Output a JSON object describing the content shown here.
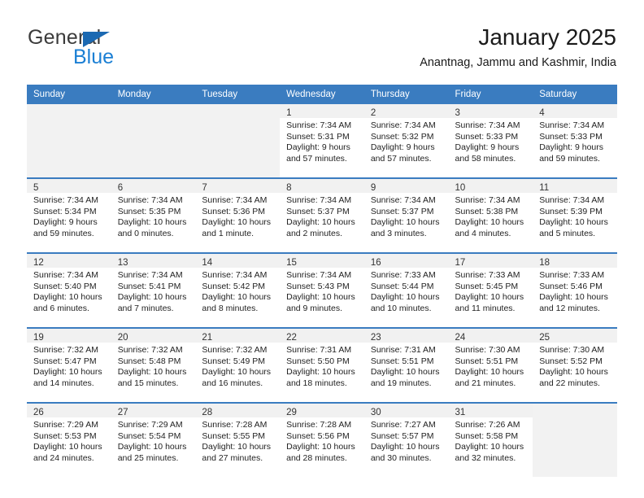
{
  "brand": {
    "name_top": "General",
    "name_bottom": "Blue",
    "triangle_color": "#1b69b2",
    "blue_color": "#1b7fd4"
  },
  "header": {
    "title": "January 2025",
    "subtitle": "Anantnag, Jammu and Kashmir, India"
  },
  "theme": {
    "header_row_bg": "#3a7cc0",
    "daynum_band_bg": "#f1f1f1",
    "empty_cell_bg": "#f2f2f2"
  },
  "weekday_headers": [
    "Sunday",
    "Monday",
    "Tuesday",
    "Wednesday",
    "Thursday",
    "Friday",
    "Saturday"
  ],
  "labels": {
    "sunrise_prefix": "Sunrise:",
    "sunset_prefix": "Sunset:",
    "daylight_prefix": "Daylight:"
  },
  "weeks": [
    [
      {
        "empty": true
      },
      {
        "empty": true
      },
      {
        "empty": true
      },
      {
        "day": "1",
        "sunrise": "Sunrise: 7:34 AM",
        "sunset": "Sunset: 5:31 PM",
        "daylight_line1": "Daylight: 9 hours",
        "daylight_line2": "and 57 minutes."
      },
      {
        "day": "2",
        "sunrise": "Sunrise: 7:34 AM",
        "sunset": "Sunset: 5:32 PM",
        "daylight_line1": "Daylight: 9 hours",
        "daylight_line2": "and 57 minutes."
      },
      {
        "day": "3",
        "sunrise": "Sunrise: 7:34 AM",
        "sunset": "Sunset: 5:33 PM",
        "daylight_line1": "Daylight: 9 hours",
        "daylight_line2": "and 58 minutes."
      },
      {
        "day": "4",
        "sunrise": "Sunrise: 7:34 AM",
        "sunset": "Sunset: 5:33 PM",
        "daylight_line1": "Daylight: 9 hours",
        "daylight_line2": "and 59 minutes."
      }
    ],
    [
      {
        "day": "5",
        "sunrise": "Sunrise: 7:34 AM",
        "sunset": "Sunset: 5:34 PM",
        "daylight_line1": "Daylight: 9 hours",
        "daylight_line2": "and 59 minutes."
      },
      {
        "day": "6",
        "sunrise": "Sunrise: 7:34 AM",
        "sunset": "Sunset: 5:35 PM",
        "daylight_line1": "Daylight: 10 hours",
        "daylight_line2": "and 0 minutes."
      },
      {
        "day": "7",
        "sunrise": "Sunrise: 7:34 AM",
        "sunset": "Sunset: 5:36 PM",
        "daylight_line1": "Daylight: 10 hours",
        "daylight_line2": "and 1 minute."
      },
      {
        "day": "8",
        "sunrise": "Sunrise: 7:34 AM",
        "sunset": "Sunset: 5:37 PM",
        "daylight_line1": "Daylight: 10 hours",
        "daylight_line2": "and 2 minutes."
      },
      {
        "day": "9",
        "sunrise": "Sunrise: 7:34 AM",
        "sunset": "Sunset: 5:37 PM",
        "daylight_line1": "Daylight: 10 hours",
        "daylight_line2": "and 3 minutes."
      },
      {
        "day": "10",
        "sunrise": "Sunrise: 7:34 AM",
        "sunset": "Sunset: 5:38 PM",
        "daylight_line1": "Daylight: 10 hours",
        "daylight_line2": "and 4 minutes."
      },
      {
        "day": "11",
        "sunrise": "Sunrise: 7:34 AM",
        "sunset": "Sunset: 5:39 PM",
        "daylight_line1": "Daylight: 10 hours",
        "daylight_line2": "and 5 minutes."
      }
    ],
    [
      {
        "day": "12",
        "sunrise": "Sunrise: 7:34 AM",
        "sunset": "Sunset: 5:40 PM",
        "daylight_line1": "Daylight: 10 hours",
        "daylight_line2": "and 6 minutes."
      },
      {
        "day": "13",
        "sunrise": "Sunrise: 7:34 AM",
        "sunset": "Sunset: 5:41 PM",
        "daylight_line1": "Daylight: 10 hours",
        "daylight_line2": "and 7 minutes."
      },
      {
        "day": "14",
        "sunrise": "Sunrise: 7:34 AM",
        "sunset": "Sunset: 5:42 PM",
        "daylight_line1": "Daylight: 10 hours",
        "daylight_line2": "and 8 minutes."
      },
      {
        "day": "15",
        "sunrise": "Sunrise: 7:34 AM",
        "sunset": "Sunset: 5:43 PM",
        "daylight_line1": "Daylight: 10 hours",
        "daylight_line2": "and 9 minutes."
      },
      {
        "day": "16",
        "sunrise": "Sunrise: 7:33 AM",
        "sunset": "Sunset: 5:44 PM",
        "daylight_line1": "Daylight: 10 hours",
        "daylight_line2": "and 10 minutes."
      },
      {
        "day": "17",
        "sunrise": "Sunrise: 7:33 AM",
        "sunset": "Sunset: 5:45 PM",
        "daylight_line1": "Daylight: 10 hours",
        "daylight_line2": "and 11 minutes."
      },
      {
        "day": "18",
        "sunrise": "Sunrise: 7:33 AM",
        "sunset": "Sunset: 5:46 PM",
        "daylight_line1": "Daylight: 10 hours",
        "daylight_line2": "and 12 minutes."
      }
    ],
    [
      {
        "day": "19",
        "sunrise": "Sunrise: 7:32 AM",
        "sunset": "Sunset: 5:47 PM",
        "daylight_line1": "Daylight: 10 hours",
        "daylight_line2": "and 14 minutes."
      },
      {
        "day": "20",
        "sunrise": "Sunrise: 7:32 AM",
        "sunset": "Sunset: 5:48 PM",
        "daylight_line1": "Daylight: 10 hours",
        "daylight_line2": "and 15 minutes."
      },
      {
        "day": "21",
        "sunrise": "Sunrise: 7:32 AM",
        "sunset": "Sunset: 5:49 PM",
        "daylight_line1": "Daylight: 10 hours",
        "daylight_line2": "and 16 minutes."
      },
      {
        "day": "22",
        "sunrise": "Sunrise: 7:31 AM",
        "sunset": "Sunset: 5:50 PM",
        "daylight_line1": "Daylight: 10 hours",
        "daylight_line2": "and 18 minutes."
      },
      {
        "day": "23",
        "sunrise": "Sunrise: 7:31 AM",
        "sunset": "Sunset: 5:51 PM",
        "daylight_line1": "Daylight: 10 hours",
        "daylight_line2": "and 19 minutes."
      },
      {
        "day": "24",
        "sunrise": "Sunrise: 7:30 AM",
        "sunset": "Sunset: 5:51 PM",
        "daylight_line1": "Daylight: 10 hours",
        "daylight_line2": "and 21 minutes."
      },
      {
        "day": "25",
        "sunrise": "Sunrise: 7:30 AM",
        "sunset": "Sunset: 5:52 PM",
        "daylight_line1": "Daylight: 10 hours",
        "daylight_line2": "and 22 minutes."
      }
    ],
    [
      {
        "day": "26",
        "sunrise": "Sunrise: 7:29 AM",
        "sunset": "Sunset: 5:53 PM",
        "daylight_line1": "Daylight: 10 hours",
        "daylight_line2": "and 24 minutes."
      },
      {
        "day": "27",
        "sunrise": "Sunrise: 7:29 AM",
        "sunset": "Sunset: 5:54 PM",
        "daylight_line1": "Daylight: 10 hours",
        "daylight_line2": "and 25 minutes."
      },
      {
        "day": "28",
        "sunrise": "Sunrise: 7:28 AM",
        "sunset": "Sunset: 5:55 PM",
        "daylight_line1": "Daylight: 10 hours",
        "daylight_line2": "and 27 minutes."
      },
      {
        "day": "29",
        "sunrise": "Sunrise: 7:28 AM",
        "sunset": "Sunset: 5:56 PM",
        "daylight_line1": "Daylight: 10 hours",
        "daylight_line2": "and 28 minutes."
      },
      {
        "day": "30",
        "sunrise": "Sunrise: 7:27 AM",
        "sunset": "Sunset: 5:57 PM",
        "daylight_line1": "Daylight: 10 hours",
        "daylight_line2": "and 30 minutes."
      },
      {
        "day": "31",
        "sunrise": "Sunrise: 7:26 AM",
        "sunset": "Sunset: 5:58 PM",
        "daylight_line1": "Daylight: 10 hours",
        "daylight_line2": "and 32 minutes."
      },
      {
        "empty": true
      }
    ]
  ]
}
